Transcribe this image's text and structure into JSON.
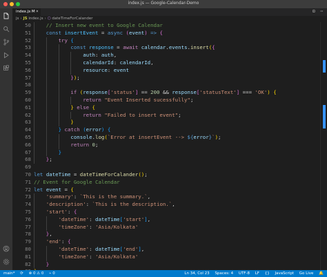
{
  "window": {
    "title": "index.js — Google-Calendar-Demo"
  },
  "tab": {
    "label": "index.js M",
    "close_glyph": "×",
    "actions": "⊡ ⋯"
  },
  "breadcrumb": {
    "folder": "js",
    "file": "index.js",
    "function": "dateTimeForCalander"
  },
  "activity_bar": [
    "files-icon",
    "search-icon",
    "source-control-icon",
    "run-debug-icon",
    "extensions-icon",
    "account-icon",
    "settings-icon"
  ],
  "lines": [
    {
      "n": "50",
      "indent": 1,
      "tokens": [
        [
          "// Insert new event to Google Calendar",
          "com"
        ]
      ]
    },
    {
      "n": "51",
      "indent": 1,
      "tokens": [
        [
          "const ",
          "kw"
        ],
        [
          "insertEvent",
          "cst"
        ],
        [
          " = ",
          ""
        ],
        [
          "async ",
          "kw"
        ],
        [
          "(",
          "par2"
        ],
        [
          "event",
          "var"
        ],
        [
          ") ",
          "par2"
        ],
        [
          "=> ",
          "kw"
        ],
        [
          "{",
          "par2"
        ]
      ]
    },
    {
      "n": "52",
      "indent": 2,
      "tokens": [
        [
          "try ",
          "ctl"
        ],
        [
          "{",
          "par3"
        ]
      ]
    },
    {
      "n": "53",
      "indent": 3,
      "tokens": [
        [
          "const ",
          "kw"
        ],
        [
          "response",
          "cst"
        ],
        [
          " = ",
          ""
        ],
        [
          "await ",
          "ctl"
        ],
        [
          "calendar",
          "var"
        ],
        [
          ".",
          ""
        ],
        [
          "events",
          "var"
        ],
        [
          ".",
          ""
        ],
        [
          "insert",
          "fn"
        ],
        [
          "(",
          "par"
        ],
        [
          "{",
          "par2"
        ]
      ]
    },
    {
      "n": "54",
      "indent": 4,
      "tokens": [
        [
          "auth",
          "var"
        ],
        [
          ": ",
          ""
        ],
        [
          "auth",
          "var"
        ],
        [
          ",",
          ""
        ]
      ]
    },
    {
      "n": "55",
      "indent": 4,
      "tokens": [
        [
          "calendarId",
          "var"
        ],
        [
          ": ",
          ""
        ],
        [
          "calendarId",
          "var"
        ],
        [
          ",",
          ""
        ]
      ]
    },
    {
      "n": "56",
      "indent": 4,
      "tokens": [
        [
          "resource",
          "var"
        ],
        [
          ": ",
          ""
        ],
        [
          "event",
          "var"
        ]
      ]
    },
    {
      "n": "57",
      "indent": 3,
      "tokens": [
        [
          "}",
          "par2"
        ],
        [
          ")",
          "par"
        ],
        [
          ";",
          ""
        ]
      ]
    },
    {
      "n": "58",
      "indent": 3,
      "tokens": []
    },
    {
      "n": "59",
      "indent": 3,
      "tokens": [
        [
          "if ",
          "ctl"
        ],
        [
          "(",
          "par"
        ],
        [
          "response",
          "var"
        ],
        [
          "[",
          "par2"
        ],
        [
          "'status'",
          "str"
        ],
        [
          "]",
          "par2"
        ],
        [
          " == ",
          ""
        ],
        [
          "200",
          "num"
        ],
        [
          " && ",
          ""
        ],
        [
          "response",
          "var"
        ],
        [
          "[",
          "par2"
        ],
        [
          "'statusText'",
          "str"
        ],
        [
          "]",
          "par2"
        ],
        [
          " === ",
          ""
        ],
        [
          "'OK'",
          "str"
        ],
        [
          ") ",
          "par"
        ],
        [
          "{",
          "par"
        ]
      ]
    },
    {
      "n": "60",
      "indent": 4,
      "tokens": [
        [
          "return ",
          "ctl"
        ],
        [
          "\"Event Inserted sucessfully\"",
          "str"
        ],
        [
          ";",
          ""
        ]
      ]
    },
    {
      "n": "61",
      "indent": 3,
      "tokens": [
        [
          "} ",
          "par"
        ],
        [
          "else ",
          "ctl"
        ],
        [
          "{",
          "par"
        ]
      ]
    },
    {
      "n": "62",
      "indent": 4,
      "tokens": [
        [
          "return ",
          "ctl"
        ],
        [
          "\"Failed to insert event\"",
          "str"
        ],
        [
          ";",
          ""
        ]
      ]
    },
    {
      "n": "63",
      "indent": 3,
      "tokens": [
        [
          "}",
          "par"
        ]
      ]
    },
    {
      "n": "64",
      "indent": 2,
      "tokens": [
        [
          "} ",
          "par3"
        ],
        [
          "catch ",
          "ctl"
        ],
        [
          "(",
          "par3"
        ],
        [
          "error",
          "var"
        ],
        [
          ") ",
          "par3"
        ],
        [
          "{",
          "par3"
        ]
      ]
    },
    {
      "n": "65",
      "indent": 3,
      "tokens": [
        [
          "console",
          "var"
        ],
        [
          ".",
          ""
        ],
        [
          "log",
          "fn"
        ],
        [
          "(",
          "par"
        ],
        [
          "`Error at insertEvent --> ",
          "str"
        ],
        [
          "${",
          "kw"
        ],
        [
          "error",
          "var"
        ],
        [
          "}",
          "kw"
        ],
        [
          "`",
          "str"
        ],
        [
          ")",
          "par"
        ],
        [
          ";",
          ""
        ]
      ]
    },
    {
      "n": "66",
      "indent": 3,
      "tokens": [
        [
          "return ",
          "ctl"
        ],
        [
          "0",
          "num"
        ],
        [
          ";",
          ""
        ]
      ]
    },
    {
      "n": "67",
      "indent": 2,
      "tokens": [
        [
          "}",
          "par3"
        ]
      ]
    },
    {
      "n": "68",
      "indent": 1,
      "tokens": [
        [
          "}",
          "par2"
        ],
        [
          ";",
          ""
        ]
      ]
    },
    {
      "n": "69",
      "indent": 0,
      "tokens": []
    },
    {
      "n": "70",
      "indent": 0,
      "tokens": [
        [
          "let ",
          "kw"
        ],
        [
          "dateTime",
          "var"
        ],
        [
          " = ",
          ""
        ],
        [
          "dateTimeForCalander",
          "fn"
        ],
        [
          "(",
          "par"
        ],
        [
          ")",
          "par"
        ],
        [
          ";",
          ""
        ]
      ]
    },
    {
      "n": "71",
      "indent": 0,
      "tokens": [
        [
          "// Event for Google Calendar",
          "com"
        ]
      ]
    },
    {
      "n": "72",
      "indent": 0,
      "tokens": [
        [
          "let ",
          "kw"
        ],
        [
          "event",
          "var"
        ],
        [
          " = ",
          ""
        ],
        [
          "{",
          "par"
        ]
      ]
    },
    {
      "n": "73",
      "indent": 1,
      "tokens": [
        [
          "'summary'",
          "str"
        ],
        [
          ": ",
          ""
        ],
        [
          "`This is the summary.`",
          "str"
        ],
        [
          ",",
          ""
        ]
      ]
    },
    {
      "n": "74",
      "indent": 1,
      "tokens": [
        [
          "'description'",
          "str"
        ],
        [
          ": ",
          ""
        ],
        [
          "`This is the description.`",
          "str"
        ],
        [
          ",",
          ""
        ]
      ]
    },
    {
      "n": "75",
      "indent": 1,
      "tokens": [
        [
          "'start'",
          "str"
        ],
        [
          ": ",
          ""
        ],
        [
          "{",
          "par2"
        ]
      ]
    },
    {
      "n": "76",
      "indent": 2,
      "tokens": [
        [
          "'dateTime'",
          "str"
        ],
        [
          ": ",
          ""
        ],
        [
          "dateTime",
          "var"
        ],
        [
          "[",
          "par3"
        ],
        [
          "'start'",
          "str"
        ],
        [
          "]",
          "par3"
        ],
        [
          ",",
          ""
        ]
      ]
    },
    {
      "n": "77",
      "indent": 2,
      "tokens": [
        [
          "'timeZone'",
          "str"
        ],
        [
          ": ",
          ""
        ],
        [
          "'Asia/Kolkata'",
          "str"
        ]
      ]
    },
    {
      "n": "78",
      "indent": 1,
      "tokens": [
        [
          "}",
          "par2"
        ],
        [
          ",",
          ""
        ]
      ]
    },
    {
      "n": "79",
      "indent": 1,
      "tokens": [
        [
          "'end'",
          "str"
        ],
        [
          ": ",
          ""
        ],
        [
          "{",
          "par2"
        ]
      ]
    },
    {
      "n": "80",
      "indent": 2,
      "tokens": [
        [
          "'dateTime'",
          "str"
        ],
        [
          ": ",
          ""
        ],
        [
          "dateTime",
          "var"
        ],
        [
          "[",
          "par3"
        ],
        [
          "'end'",
          "str"
        ],
        [
          "]",
          "par3"
        ],
        [
          ",",
          ""
        ]
      ]
    },
    {
      "n": "81",
      "indent": 2,
      "tokens": [
        [
          "'timeZone'",
          "str"
        ],
        [
          ": ",
          ""
        ],
        [
          "'Asia/Kolkata'",
          "str"
        ]
      ]
    },
    {
      "n": "82",
      "indent": 1,
      "tokens": [
        [
          "}",
          "par2"
        ]
      ]
    },
    {
      "n": "83",
      "indent": 0,
      "tokens": [
        [
          "}",
          "par"
        ],
        [
          ";",
          ""
        ]
      ]
    },
    {
      "n": "84",
      "indent": 0,
      "tokens": []
    }
  ],
  "status": {
    "branch": "main*",
    "sync": "⟳",
    "problems": "⊗ 0  ⚠ 0",
    "ports": "⌁ 0",
    "position": "Ln 34, Col 23",
    "spaces": "Spaces: 4",
    "encoding": "UTF-8",
    "eol": "LF",
    "braces": "{}",
    "language": "JavaScript",
    "golive": "Go Live",
    "bell": "🔔"
  },
  "colors": {
    "statusbar": "#007acc",
    "activity": "#333333",
    "editor": "#1e1e1e"
  }
}
